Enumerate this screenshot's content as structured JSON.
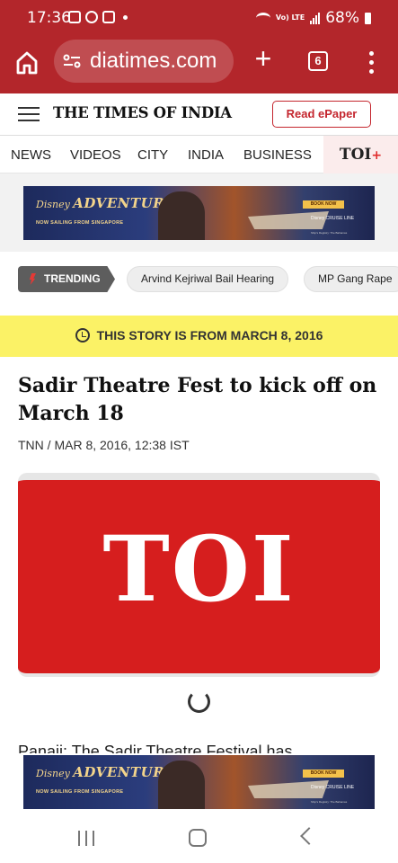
{
  "status_bar": {
    "time": "17:36",
    "lte_label": "Vo) LTE",
    "battery": "68%"
  },
  "browser": {
    "url": "diatimes.com",
    "tab_count": "6",
    "plus": "+"
  },
  "site": {
    "logo": "THE TIMES OF INDIA",
    "epaper_label": "Read ePaper"
  },
  "nav": {
    "items": [
      "NEWS",
      "VIDEOS",
      "CITY",
      "INDIA",
      "BUSINESS"
    ],
    "toi_plus": "TOI",
    "toi_plus_mark": "+"
  },
  "ad": {
    "brand": "Disney",
    "title": "ADVENTURE",
    "subtitle": "NOW SAILING FROM SINGAPORE",
    "cta": "BOOK NOW",
    "cruise_line": "Disney CRUISE LINE",
    "fine_print": "Ship's Registry: The Bahamas"
  },
  "trending": {
    "label": "TRENDING",
    "chips": [
      "Arvind Kejriwal Bail Hearing",
      "MP Gang Rape"
    ]
  },
  "notice": {
    "text": "THIS STORY IS FROM MARCH 8, 2016"
  },
  "article": {
    "headline": "Sadir Theatre Fest to kick off on March 18",
    "byline": "TNN / MAR 8, 2016, 12:38 IST",
    "image_text": "TOI",
    "body_start": "Panaji: The Sadir Theatre Festival has"
  },
  "colors": {
    "browser_bar": "#b3262b",
    "brand_red": "#c4262e",
    "notice_yellow": "#fbf266",
    "toi_red": "#d61e1e"
  }
}
